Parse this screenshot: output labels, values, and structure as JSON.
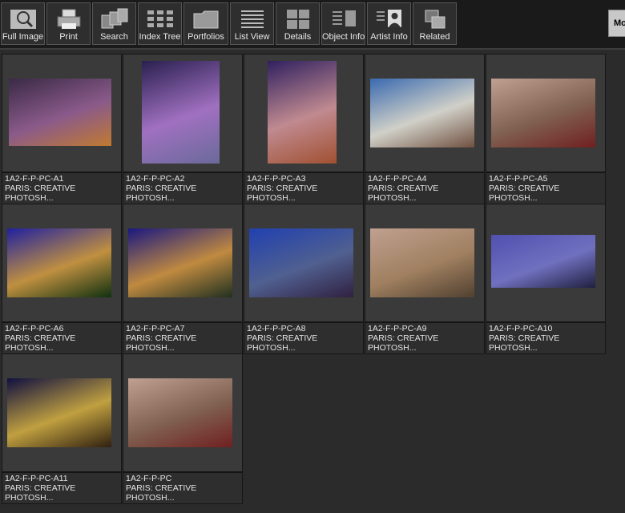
{
  "toolbar": {
    "buttons": [
      {
        "label": "Full Image",
        "icon": "magnifier-icon"
      },
      {
        "label": "Print",
        "icon": "printer-icon"
      },
      {
        "label": "Search",
        "icon": "search-cards-icon"
      },
      {
        "label": "Index Tree",
        "icon": "index-tree-icon"
      },
      {
        "label": "Portfolios",
        "icon": "folder-icon"
      },
      {
        "label": "List View",
        "icon": "list-view-icon"
      },
      {
        "label": "Details",
        "icon": "details-icon"
      },
      {
        "label": "Object Info",
        "icon": "object-info-icon"
      },
      {
        "label": "Artist  Info",
        "icon": "artist-portrait-icon"
      },
      {
        "label": "Related",
        "icon": "related-icon"
      }
    ],
    "more_label": "Mo"
  },
  "thumbnails": [
    {
      "id": "1A2-F-P-PC-A1",
      "line2": "PARIS: CREATIVE",
      "line3": "PHOTOSH...",
      "colors": [
        "#3a2a45",
        "#8a5a8a",
        "#c07a30"
      ]
    },
    {
      "id": "1A2-F-P-PC-A2",
      "line2": "PARIS: CREATIVE",
      "line3": "PHOTOSH...",
      "colors": [
        "#2a2050",
        "#a070c0",
        "#6a6a9a"
      ]
    },
    {
      "id": "1A2-F-P-PC-A3",
      "line2": "PARIS: CREATIVE",
      "line3": "PHOTOSH...",
      "colors": [
        "#302060",
        "#c08a90",
        "#a05030"
      ]
    },
    {
      "id": "1A2-F-P-PC-A4",
      "line2": "PARIS: CREATIVE",
      "line3": "PHOTOSH...",
      "colors": [
        "#3a6ab0",
        "#d0d0c8",
        "#705040"
      ]
    },
    {
      "id": "1A2-F-P-PC-A5",
      "line2": "PARIS: CREATIVE",
      "line3": "PHOTOSH...",
      "colors": [
        "#c0a090",
        "#806050",
        "#702020"
      ]
    },
    {
      "id": "1A2-F-P-PC-A6",
      "line2": "PARIS: CREATIVE",
      "line3": "PHOTOSH...",
      "colors": [
        "#2020a0",
        "#c09040",
        "#103010"
      ]
    },
    {
      "id": "1A2-F-P-PC-A7",
      "line2": "PARIS: CREATIVE",
      "line3": "PHOTOSH...",
      "colors": [
        "#1a1880",
        "#c08a40",
        "#203020"
      ]
    },
    {
      "id": "1A2-F-P-PC-A8",
      "line2": "PARIS: CREATIVE",
      "line3": "PHOTOSH...",
      "colors": [
        "#2040b0",
        "#506090",
        "#302040"
      ]
    },
    {
      "id": "1A2-F-P-PC-A9",
      "line2": "PARIS: CREATIVE",
      "line3": "PHOTOSH...",
      "colors": [
        "#c0a090",
        "#a08060",
        "#504030"
      ]
    },
    {
      "id": "1A2-F-P-PC-A10",
      "line2": "PARIS: CREATIVE",
      "line3": "PHOTOSH...",
      "colors": [
        "#5050b0",
        "#7070c0",
        "#202040"
      ]
    },
    {
      "id": "1A2-F-P-PC-A11",
      "line2": "PARIS: CREATIVE",
      "line3": "PHOTOSH...",
      "colors": [
        "#101040",
        "#c0a040",
        "#302010"
      ]
    },
    {
      "id": "1A2-F-P-PC",
      "line2": "PARIS: CREATIVE",
      "line3": "PHOTOSH...",
      "colors": [
        "#c0a090",
        "#806050",
        "#702020"
      ]
    }
  ]
}
